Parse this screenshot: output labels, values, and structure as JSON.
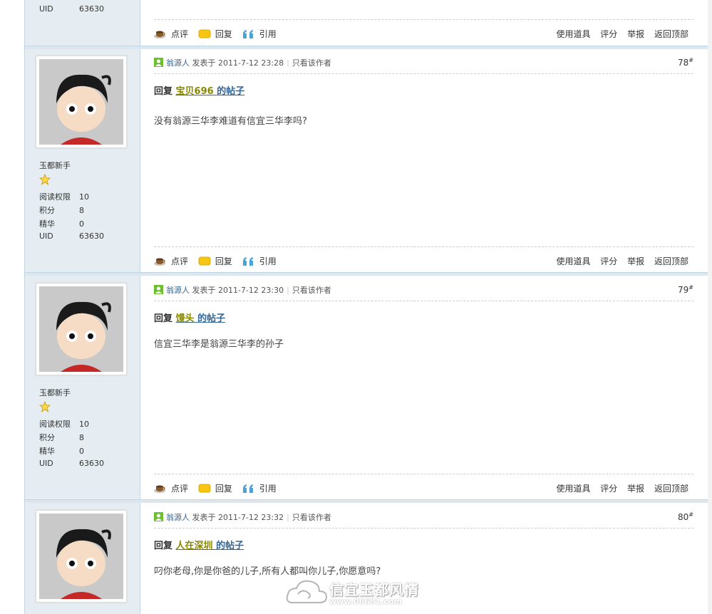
{
  "colors": {
    "sidebar_bg": "#e5edf2",
    "border": "#c2d5e3",
    "link": "#336699",
    "name_olive": "#888800"
  },
  "top_post": {
    "uid_label": "UID",
    "uid_value": "63630",
    "actions": {
      "comment": "点评",
      "reply": "回复",
      "quote": "引用"
    },
    "tools": {
      "use_tool": "使用道具",
      "rate": "评分",
      "report": "举报",
      "top": "返回顶部"
    }
  },
  "posts": [
    {
      "rank": "玉都新手",
      "stats": [
        {
          "k": "阅读权限",
          "v": "10"
        },
        {
          "k": "积分",
          "v": "8"
        },
        {
          "k": "精华",
          "v": "0"
        },
        {
          "k": "UID",
          "v": "63630"
        }
      ],
      "author": "翁源人",
      "posted": "发表于 2011-7-12 23:28",
      "author_only": "只看该作者",
      "floor": "78",
      "reply_prefix": "回复",
      "quoted_user": "宝贝696",
      "reply_suffix": "的帖子",
      "message": "没有翁源三华李难道有信宜三华李吗?",
      "actions": {
        "comment": "点评",
        "reply": "回复",
        "quote": "引用"
      },
      "tools": {
        "use_tool": "使用道具",
        "rate": "评分",
        "report": "举报",
        "top": "返回顶部"
      }
    },
    {
      "rank": "玉都新手",
      "stats": [
        {
          "k": "阅读权限",
          "v": "10"
        },
        {
          "k": "积分",
          "v": "8"
        },
        {
          "k": "精华",
          "v": "0"
        },
        {
          "k": "UID",
          "v": "63630"
        }
      ],
      "author": "翁源人",
      "posted": "发表于 2011-7-12 23:30",
      "author_only": "只看该作者",
      "floor": "79",
      "reply_prefix": "回复",
      "quoted_user": "馒头",
      "reply_suffix": "的帖子",
      "message": "信宜三华李是翁源三华李的孙子",
      "actions": {
        "comment": "点评",
        "reply": "回复",
        "quote": "引用"
      },
      "tools": {
        "use_tool": "使用道具",
        "rate": "评分",
        "report": "举报",
        "top": "返回顶部"
      }
    },
    {
      "author": "翁源人",
      "posted": "发表于 2011-7-12 23:32",
      "author_only": "只看该作者",
      "floor": "80",
      "reply_prefix": "回复",
      "quoted_user": "人在深圳",
      "reply_suffix": "的帖子",
      "message": "叼你老母,你是你爸的儿子,所有人都叫你儿子,你愿意吗?"
    }
  ],
  "floor_mark": "#",
  "watermark": {
    "title": "信宜玉都风情",
    "url": "www.06681.com"
  }
}
